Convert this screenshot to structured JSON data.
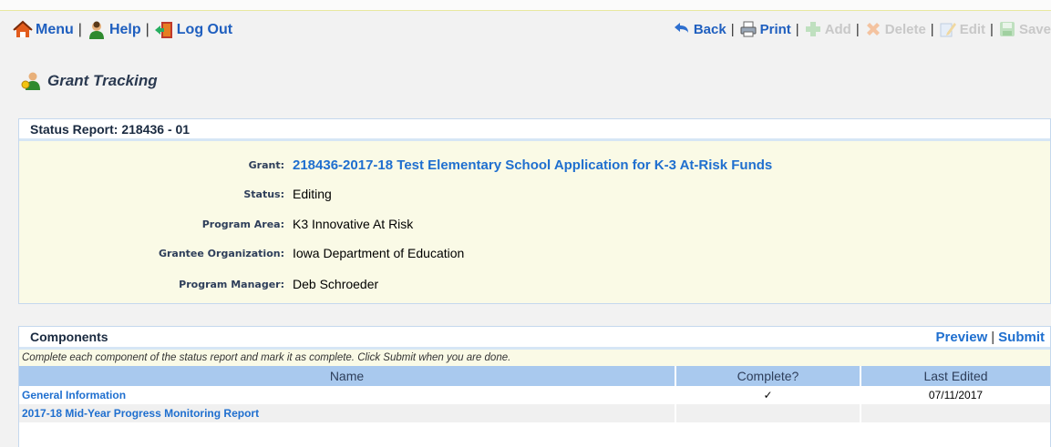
{
  "toolbar": {
    "left": [
      {
        "label": "Menu",
        "icon": "menu-icon"
      },
      {
        "label": "Help",
        "icon": "help-icon"
      },
      {
        "label": "Log Out",
        "icon": "logout-icon"
      }
    ],
    "right": [
      {
        "label": "Back",
        "icon": "back-icon",
        "enabled": true
      },
      {
        "label": "Print",
        "icon": "print-icon",
        "enabled": true
      },
      {
        "label": "Add",
        "icon": "add-icon",
        "enabled": false
      },
      {
        "label": "Delete",
        "icon": "delete-icon",
        "enabled": false
      },
      {
        "label": "Edit",
        "icon": "edit-icon",
        "enabled": false
      },
      {
        "label": "Save",
        "icon": "save-icon",
        "enabled": false
      }
    ],
    "separator": "|"
  },
  "page_title": "Grant Tracking",
  "status_report": {
    "header": "Status Report: 218436 - 01",
    "fields": [
      {
        "label": "Grant:",
        "value": "218436-2017-18 Test Elementary School Application for K-3 At-Risk Funds",
        "link": true
      },
      {
        "label": "Status:",
        "value": "Editing",
        "link": false
      },
      {
        "label": "Program Area:",
        "value": "K3 Innovative At Risk",
        "link": false
      },
      {
        "label": "Grantee Organization:",
        "value": "Iowa Department of Education",
        "link": false
      },
      {
        "label": "Program Manager:",
        "value": "Deb Schroeder",
        "link": false
      }
    ]
  },
  "components": {
    "header": "Components",
    "preview_label": "Preview",
    "submit_label": "Submit",
    "separator": "|",
    "instructions": "Complete each component of the status report and mark it as complete. Click Submit when you are done.",
    "columns": [
      "Name",
      "Complete?",
      "Last Edited"
    ],
    "rows": [
      {
        "name": "General Information",
        "complete": "✓",
        "last_edited": "07/11/2017"
      },
      {
        "name": "2017-18 Mid-Year Progress Monitoring Report",
        "complete": "",
        "last_edited": ""
      }
    ]
  },
  "colors": {
    "link": "#1f6fcf",
    "panel_bg": "#fafae6",
    "table_header": "#a9c9ee",
    "disabled": "#c8c8c8"
  }
}
